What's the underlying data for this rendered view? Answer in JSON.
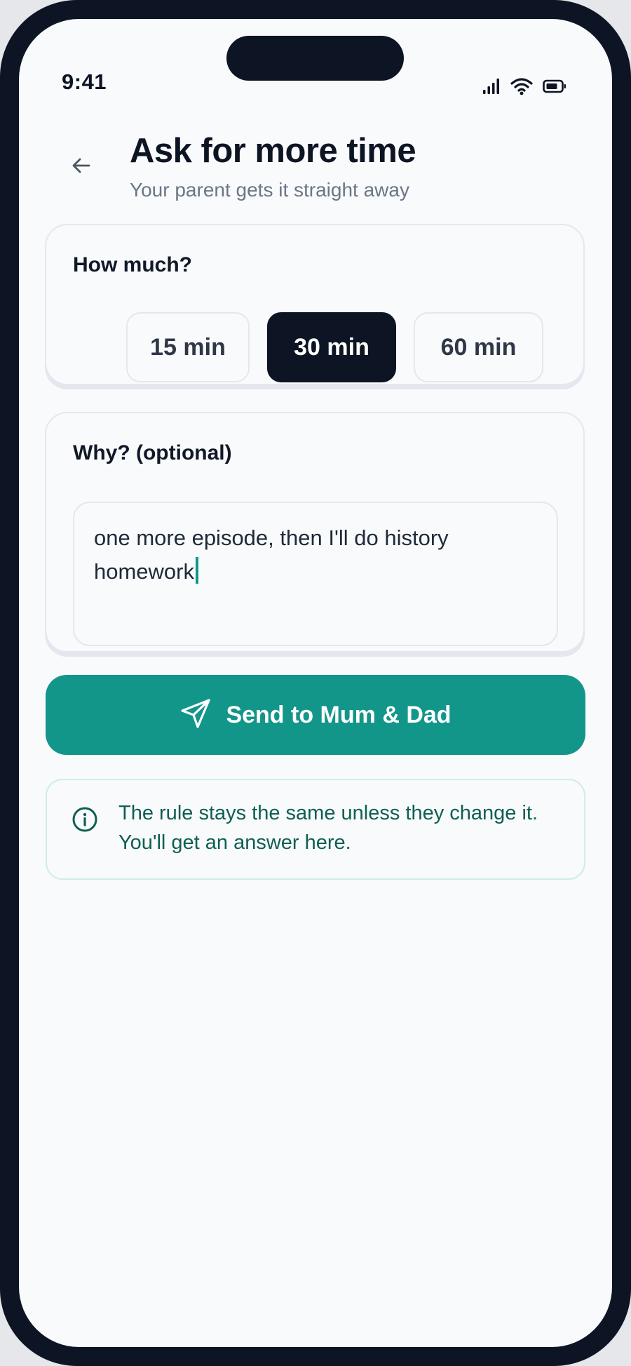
{
  "status_bar": {
    "time": "9:41",
    "icons": [
      "cellular-signal-icon",
      "wifi-icon",
      "battery-icon"
    ]
  },
  "header": {
    "back_icon": "arrow-left-icon",
    "title": "Ask for more time",
    "subtitle": "Your parent gets it straight away"
  },
  "amount": {
    "label": "How much?",
    "options": [
      "15 min",
      "30 min",
      "60 min"
    ],
    "selected": "30 min"
  },
  "reason": {
    "label": "Why? (optional)",
    "value": "one more episode, then I'll do history homework"
  },
  "send": {
    "label": "Send to Mum & Dad",
    "icon": "paper-plane-icon"
  },
  "info": {
    "icon": "info-icon",
    "text": "The rule stays the same unless they change it. You'll get an answer here."
  },
  "colors": {
    "accent": "#12968a",
    "dark": "#0d1423",
    "background": "#f8fafc",
    "info_text": "#0f5f52"
  }
}
